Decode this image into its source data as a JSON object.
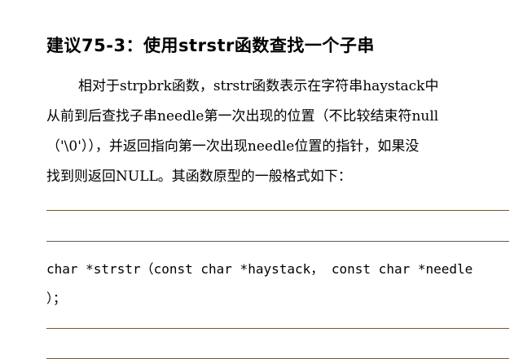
{
  "section": {
    "heading": "建议75-3：使用strstr函数查找一个子串"
  },
  "body": {
    "lines": [
      "相对于strpbrk函数，strstr函数表示在字符串haystack中",
      "从前到后查找子串needle第一次出现的位置（不比较结束符null",
      "（'\\0'）），并返回指向第一次出现needle位置的指针，如果没",
      "找到则返回NULL。其函数原型的一般格式如下："
    ]
  },
  "code": {
    "lines": [
      "char *strstr（const char *haystack， const char *needle",
      "）；"
    ]
  }
}
